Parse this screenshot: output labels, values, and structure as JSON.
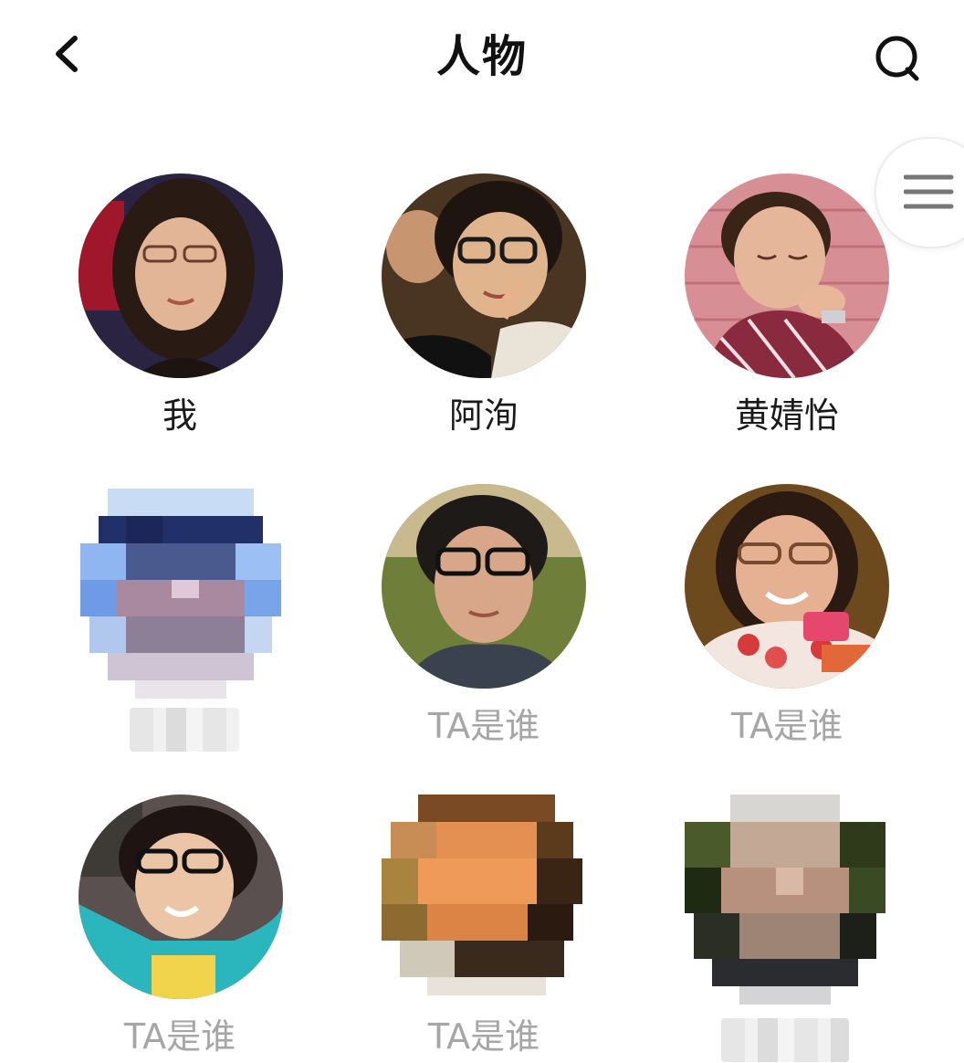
{
  "header": {
    "title": "人物",
    "back_icon": "chevron-left-icon",
    "search_icon": "search-icon",
    "menu_icon": "hamburger-menu-icon"
  },
  "people": [
    {
      "name": "我",
      "style": "named",
      "photo": "portrait-woman-glasses"
    },
    {
      "name": "阿洵",
      "style": "named",
      "photo": "portrait-woman-peace-sign"
    },
    {
      "name": "黄婧怡",
      "style": "named",
      "photo": "portrait-woman-hand-on-chin"
    },
    {
      "name": "",
      "style": "pixelated",
      "photo": "pixelated-face-blue"
    },
    {
      "name": "TA是谁",
      "style": "unknown",
      "photo": "portrait-woman-short-hair-glasses"
    },
    {
      "name": "TA是谁",
      "style": "unknown",
      "photo": "portrait-woman-with-cake"
    },
    {
      "name": "TA是谁",
      "style": "unknown",
      "photo": "portrait-woman-teal-jacket"
    },
    {
      "name": "TA是谁",
      "style": "unknown",
      "photo": "pixelated-face-orange"
    },
    {
      "name": "",
      "style": "pixelated",
      "photo": "pixelated-face-gray"
    }
  ]
}
